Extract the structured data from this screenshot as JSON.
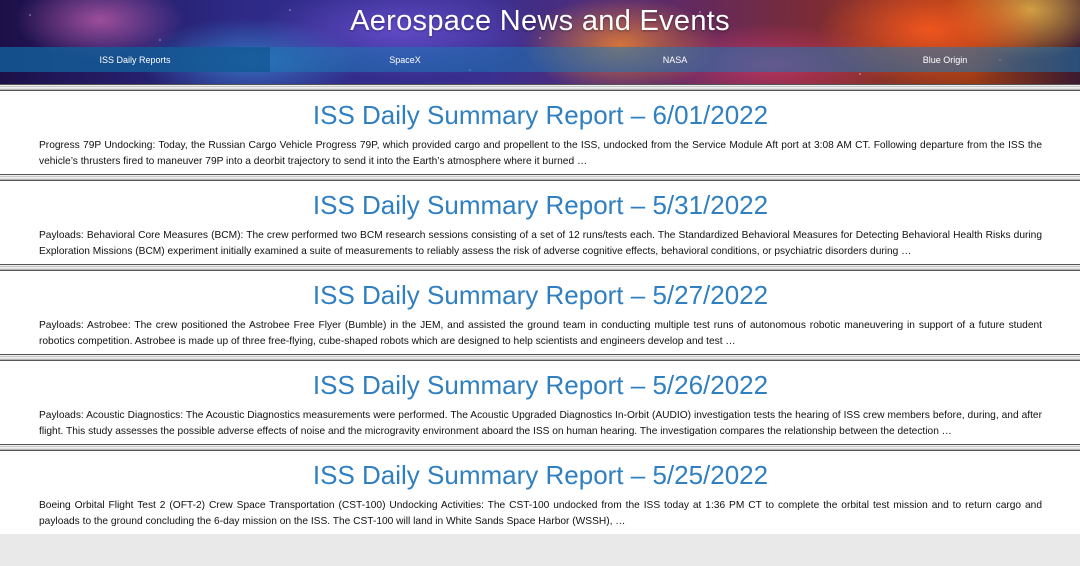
{
  "site": {
    "title": "Aerospace News and Events"
  },
  "nav": {
    "tabs": [
      {
        "label": "ISS Daily Reports"
      },
      {
        "label": "SpaceX"
      },
      {
        "label": "NASA"
      },
      {
        "label": "Blue Origin"
      }
    ]
  },
  "reports": [
    {
      "title": "ISS Daily Summary Report – 6/01/2022",
      "excerpt": "Progress 79P Undocking: Today, the Russian Cargo Vehicle Progress 79P, which provided cargo and propellent to the ISS, undocked from the Service Module Aft port at 3:08 AM CT. Following departure from the ISS the vehicle’s thrusters fired to maneuver 79P into a deorbit trajectory to send it into the Earth’s atmosphere where it burned …"
    },
    {
      "title": "ISS Daily Summary Report – 5/31/2022",
      "excerpt": "Payloads: Behavioral Core Measures (BCM): The crew performed two BCM research sessions consisting of a set of 12 runs/tests each. The Standardized Behavioral Measures for Detecting Behavioral Health Risks during Exploration Missions (BCM) experiment initially examined a suite of measurements to reliably assess the risk of adverse cognitive effects, behavioral conditions, or psychiatric disorders during …"
    },
    {
      "title": "ISS Daily Summary Report – 5/27/2022",
      "excerpt": "Payloads: Astrobee: The crew positioned the Astrobee Free Flyer (Bumble) in the JEM, and assisted the ground team in conducting multiple test runs of autonomous robotic maneuvering in support of a future student robotics competition. Astrobee is made up of three free-flying, cube-shaped robots which are designed to help scientists and engineers develop and test …"
    },
    {
      "title": "ISS Daily Summary Report – 5/26/2022",
      "excerpt": "Payloads: Acoustic Diagnostics: The Acoustic Diagnostics measurements were performed. The Acoustic Upgraded Diagnostics In-Orbit (AUDIO) investigation tests the hearing of ISS crew members before, during, and after flight. This study assesses the possible adverse effects of noise and the microgravity environment aboard the ISS on human hearing. The investigation compares the relationship between the detection …"
    },
    {
      "title": "ISS Daily Summary Report – 5/25/2022",
      "excerpt": "Boeing Orbital Flight Test 2 (OFT-2) Crew Space Transportation (CST-100) Undocking Activities: The CST-100 undocked from the ISS today at 1:36 PM CT to complete the orbital test mission and to return cargo and payloads to the ground concluding the 6-day mission on the ISS. The CST-100 will land in White Sands Space Harbor (WSSH), …"
    }
  ]
}
